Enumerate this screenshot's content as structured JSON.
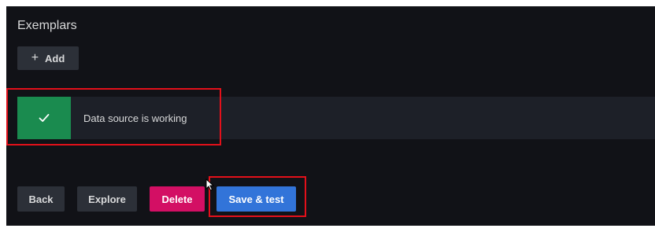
{
  "exemplars": {
    "title": "Exemplars",
    "add_button": {
      "icon": "plus-icon",
      "glyph": "+",
      "label": "Add"
    }
  },
  "status_alert": {
    "icon": "checkmark-icon",
    "message": "Data source is working",
    "colors": {
      "icon_background": "#1a8b4f",
      "background": "#1d2028"
    }
  },
  "actions": {
    "back_label": "Back",
    "explore_label": "Explore",
    "delete_label": "Delete",
    "save_test_label": "Save & test"
  },
  "colors": {
    "background": "#111217",
    "secondary_button": "#2c3038",
    "delete_button": "#d30f64",
    "primary_button": "#3274d9",
    "highlight_box": "#e3101a"
  }
}
